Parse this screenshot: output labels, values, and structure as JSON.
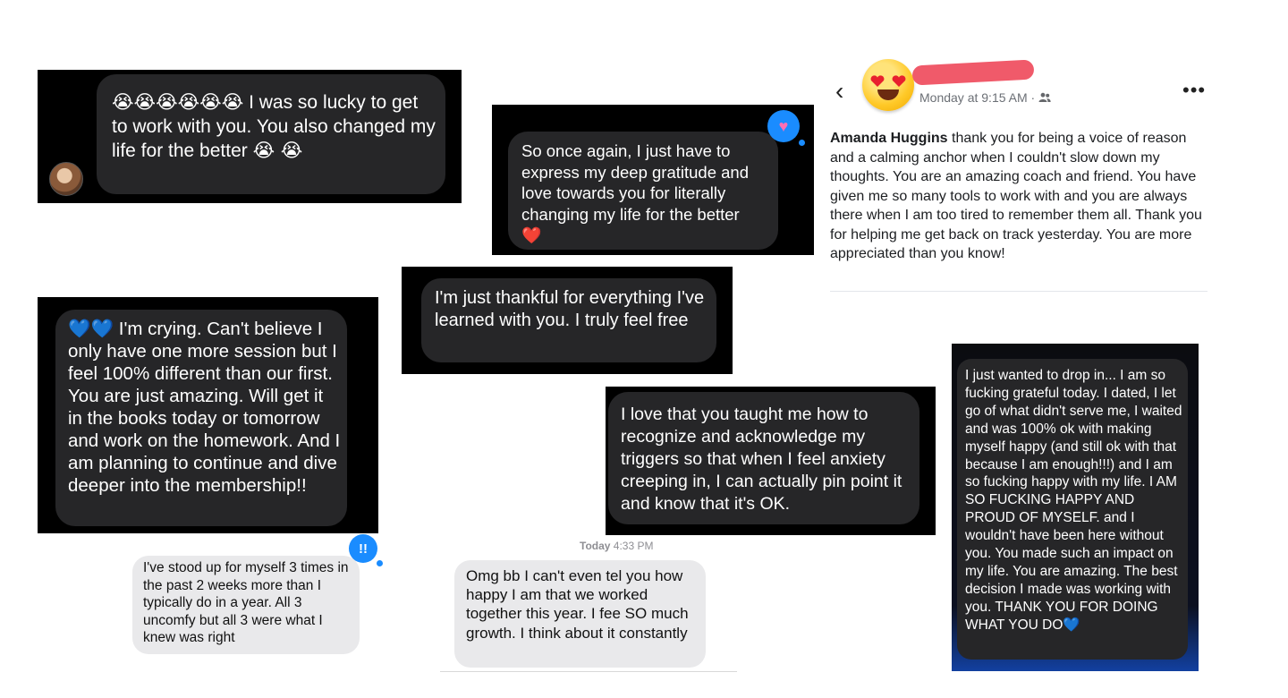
{
  "msg1": {
    "emojis": "😭😭😭😭😭😭",
    "text": "I was so lucky to get to work with you.  You also changed my life for the better",
    "trailing_emoji": "😭 😭"
  },
  "msg2": {
    "text": "So once again, I just have to express my deep gratitude and love towards you for literally changing my life for the better",
    "emoji": "❤️",
    "reaction": "♥"
  },
  "msg3": {
    "text": "I'm just thankful for everything I've learned with you. I truly feel free"
  },
  "msg4": {
    "emojis": "💙💙",
    "text": "I'm crying. Can't believe I only have one more session but I feel 100% different than our first. You are just amazing. Will get it in the books today or tomorrow and work on the homework. And I am planning to continue and dive deeper into the membership!!"
  },
  "msg5": {
    "text": "I love that you taught me how to recognize and acknowledge my triggers so that when I feel anxiety creeping in, I can actually pin point it and know that it's OK."
  },
  "msg6": {
    "text": "I've stood up for myself 3 times in the past 2 weeks more than I typically do in a year. All 3 uncomfy but all 3 were what I knew was right",
    "reaction": "!!"
  },
  "msg7": {
    "timestamp_day": "Today",
    "timestamp_time": "4:33 PM",
    "text": "Omg bb I can't even tel you how happy I am that we worked together this year. I fee SO much growth. I think about it constantly"
  },
  "msg8": {
    "text": "I just wanted to drop in... I am so fucking grateful today. I dated, I let go of what didn't serve me, I waited and was 100% ok with making myself happy (and still ok with that because I am enough!!!) and I am so fucking happy with my life. I AM SO FUCKING HAPPY AND PROUD OF MYSELF. and I wouldn't have been here without you. You made such an impact on my life. You are amazing. The best decision I made was working with you. THANK YOU FOR DOING WHAT YOU DO",
    "emoji": "💙"
  },
  "fb_post": {
    "timestamp": "Monday at 9:15 AM ·",
    "audience_icon": "friends-icon",
    "author": "Amanda Huggins",
    "text": "thank you for being a voice of reason and a calming anchor when I couldn't slow down my thoughts.  You are an amazing coach and friend.  You have given me so many tools to work with and you are always there when I am too tired to remember them all.  Thank you for helping me get back on track yesterday.  You are more appreciated than you know!",
    "back_icon": "‹",
    "more_icon": "•••"
  }
}
